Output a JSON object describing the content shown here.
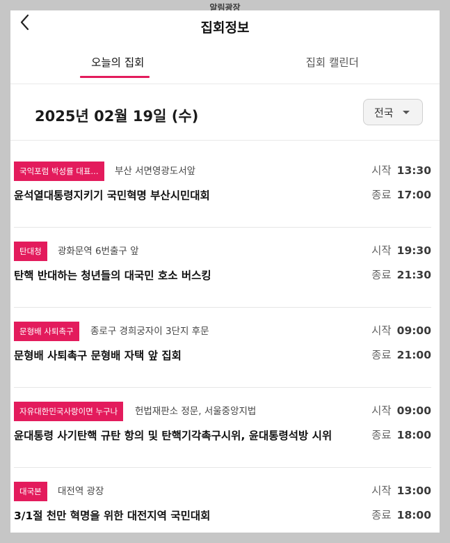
{
  "window": {
    "title": "알림광장"
  },
  "header": {
    "title": "집회정보"
  },
  "tabs": [
    {
      "label": "오늘의 집회"
    },
    {
      "label": "집회 캘린더"
    }
  ],
  "date": {
    "text": "2025년 02월 19일 (수)"
  },
  "region": {
    "selected": "전국"
  },
  "labels": {
    "start": "시작",
    "end": "종료"
  },
  "colors": {
    "accent": "#e31b5c"
  },
  "events": [
    {
      "badge": "국익포럼 박성률 대표...",
      "location": "부산 서면영광도서앞",
      "title": "윤석열대통령지키기 국민혁명 부산시민대회",
      "start": "13:30",
      "end": "17:00"
    },
    {
      "badge": "탄대청",
      "location": "광화문역 6번출구 앞",
      "title": "탄핵 반대하는 청년들의 대국민 호소 버스킹",
      "start": "19:30",
      "end": "21:30"
    },
    {
      "badge": "문형배 사퇴촉구",
      "location": "종로구 경희궁자이 3단지 후문",
      "title": "문형배 사퇴촉구 문형배 자택 앞 집회",
      "start": "09:00",
      "end": "21:00"
    },
    {
      "badge": "자유대한민국사랑이면 누구나",
      "location": "헌법재판소 정문, 서울중앙지법",
      "title": "윤대통령 사기탄핵 규탄 항의 및 탄핵기각촉구시위, 윤대통령석방 시위",
      "start": "09:00",
      "end": "18:00"
    },
    {
      "badge": "대국본",
      "location": "대전역 광장",
      "title": "3/1절 천만 혁명을 위한 대전지역 국민대회",
      "start": "13:00",
      "end": "18:00"
    }
  ]
}
